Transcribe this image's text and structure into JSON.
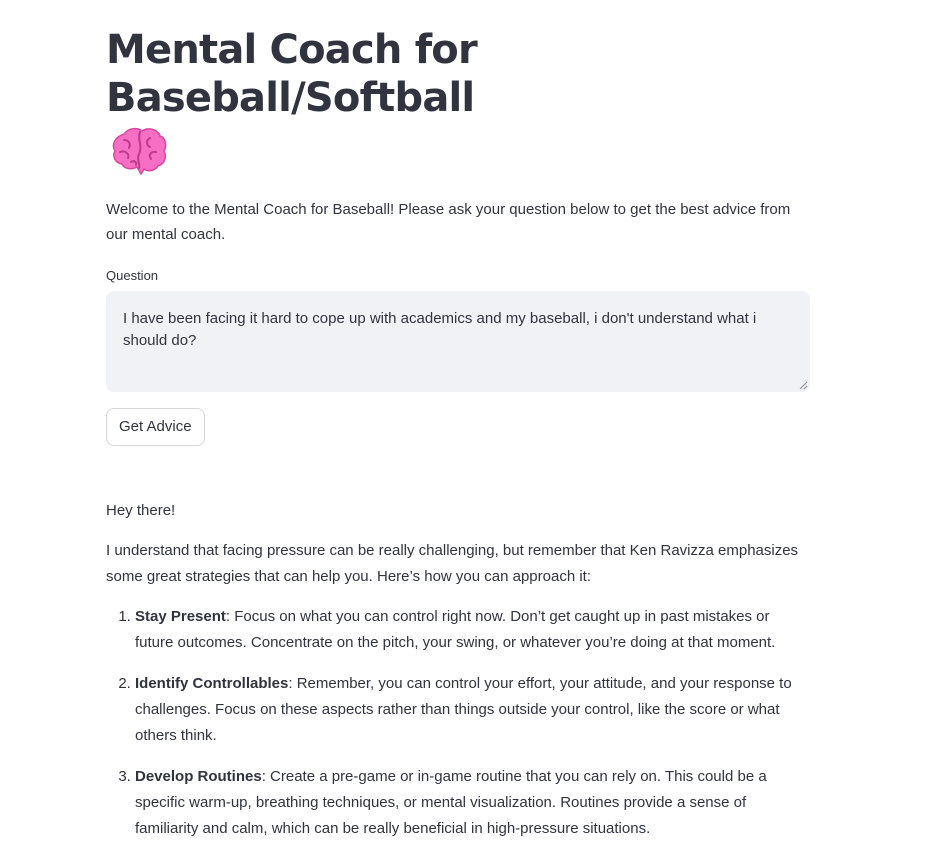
{
  "page": {
    "title": "Mental Coach for Baseball/Softball",
    "title_icon": "brain-emoji",
    "intro": "Welcome to the Mental Coach for Baseball! Please ask your question below to get the best advice from our mental coach."
  },
  "form": {
    "question_label": "Question",
    "question_value": "I have been facing it hard to cope up with academics and my baseball, i don't understand what i should do?",
    "button_label": "Get Advice"
  },
  "response": {
    "greeting": "Hey there!",
    "paragraph": "I understand that facing pressure can be really challenging, but remember that Ken Ravizza emphasizes some great strategies that can help you. Here’s how you can approach it:",
    "items": [
      {
        "title": "Stay Present",
        "text": ": Focus on what you can control right now. Don’t get caught up in past mistakes or future outcomes. Concentrate on the pitch, your swing, or whatever you’re doing at that moment."
      },
      {
        "title": "Identify Controllables",
        "text": ": Remember, you can control your effort, your attitude, and your response to challenges. Focus on these aspects rather than things outside your control, like the score or what others think."
      },
      {
        "title": "Develop Routines",
        "text": ": Create a pre-game or in-game routine that you can rely on. This could be a specific warm-up, breathing techniques, or mental visualization. Routines provide a sense of familiarity and calm, which can be really beneficial in high-pressure situations."
      }
    ]
  },
  "colors": {
    "text": "#31333f",
    "input_bg": "#f0f2f6",
    "button_border": "#d6d6d9",
    "brain_pink": "#f76ec5"
  }
}
